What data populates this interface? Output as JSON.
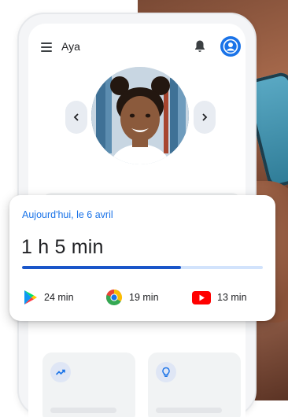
{
  "header": {
    "profile_name": "Aya"
  },
  "summary": {
    "date_label": "Aujourd'hui, le 6 avril",
    "total_time": "1 h 5 min",
    "progress_fraction": 0.66
  },
  "apps": [
    {
      "icon": "google-play-icon",
      "time": "24 min"
    },
    {
      "icon": "chrome-icon",
      "time": "19 min"
    },
    {
      "icon": "youtube-icon",
      "time": "13 min"
    }
  ],
  "colors": {
    "accent_blue": "#1a73e8",
    "progress_fill": "#1a56c9",
    "progress_track": "#d2e3fc",
    "youtube_red": "#ff0000"
  }
}
